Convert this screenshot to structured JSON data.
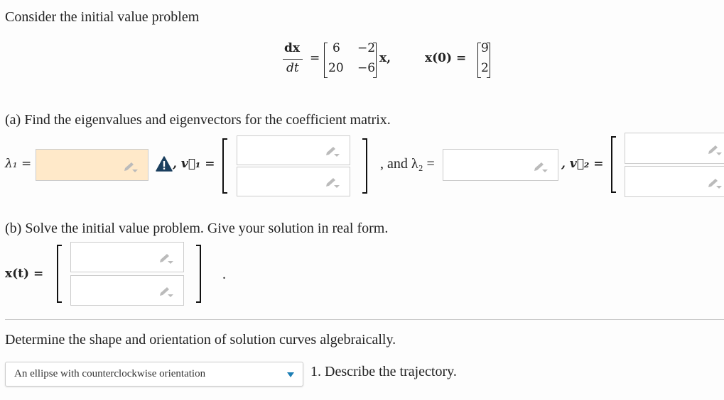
{
  "intro": "Consider the initial value problem",
  "equation": {
    "lhs_num": "dx",
    "lhs_den": "dt",
    "eq": "=",
    "matrix": [
      [
        "6",
        "−2"
      ],
      [
        "20",
        "−6"
      ]
    ],
    "after_matrix": "x,",
    "ic_label": "x(0) =",
    "ic_vector": [
      "9",
      "2"
    ]
  },
  "part_a": {
    "prompt": "(a) Find the eigenvalues and eigenvectors for the coefficient matrix.",
    "lambda1_label": "λ₁ =",
    "lambda1_value": "",
    "v1_label": ", v⃗₁ =",
    "v1_values": [
      "",
      ""
    ],
    "and_lambda2_label": ", and λ₂ =",
    "lambda2_value": "",
    "v2_label": ", v⃗₂ =",
    "v2_values": [
      "",
      ""
    ],
    "warning_icon": "warning-triangle-icon",
    "warning_color": "#1b3f5e",
    "highlight_color": "#ffe9c9"
  },
  "part_b": {
    "prompt": "(b) Solve the initial value problem. Give your solution in real form.",
    "x_label": "x(t) =",
    "x_values": [
      "",
      ""
    ],
    "period": "."
  },
  "part_c": {
    "prompt": "Determine the shape and orientation of solution curves algebraically.",
    "dropdown_value": "An ellipse with counterclockwise orientation",
    "dropdown_caret_color": "#1d7fb5",
    "describe_label": "1. Describe the trajectory."
  }
}
